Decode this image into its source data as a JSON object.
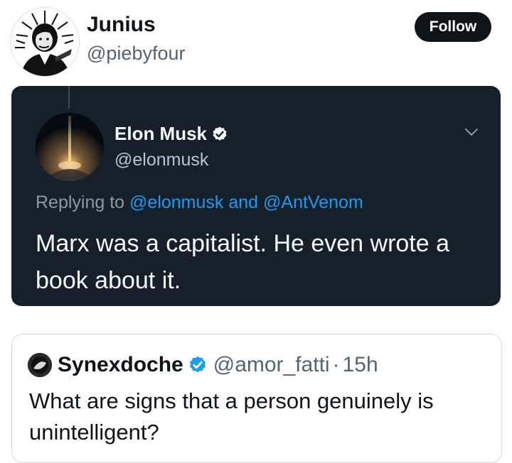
{
  "author": {
    "name": "Junius",
    "handle": "@piebyfour",
    "follow_label": "Follow"
  },
  "embedded_tweet": {
    "name": "Elon Musk",
    "handle": "@elonmusk",
    "reply_prefix": "Replying to",
    "reply_mention_1": "@elonmusk",
    "reply_conjunction": "and",
    "reply_mention_2": "@AntVenom",
    "text": "Marx was a capitalist. He even wrote a book about it.",
    "icons": [
      "verified-icon",
      "chevron-down-icon"
    ]
  },
  "quoted_tweet": {
    "name": "Synexdoche",
    "handle": "@amor_fatti",
    "separator": "·",
    "time": "15h",
    "text": "What are signs that a person genuinely is unintelligent?",
    "icons": [
      "verified-icon"
    ]
  },
  "colors": {
    "dark_card_bg": "#15202b",
    "mention_blue": "#1d9bf0",
    "verified_blue": "#1d9bf0",
    "button_bg": "#0f1419"
  }
}
